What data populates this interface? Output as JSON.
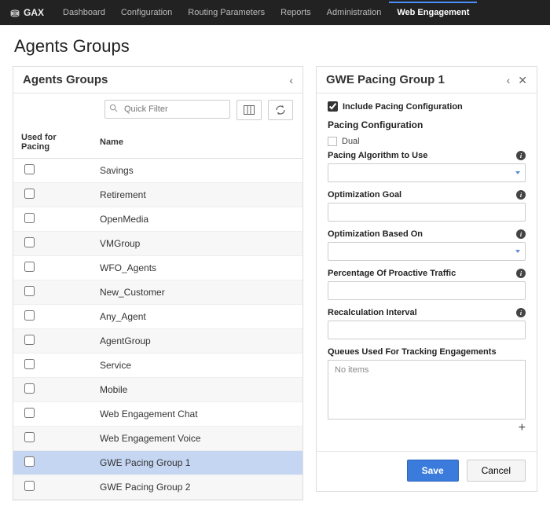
{
  "nav": {
    "brand": "GAX",
    "items": [
      "Dashboard",
      "Configuration",
      "Routing Parameters",
      "Reports",
      "Administration",
      "Web Engagement"
    ],
    "active": "Web Engagement"
  },
  "page": {
    "title": "Agents Groups"
  },
  "left": {
    "title": "Agents Groups",
    "search_placeholder": "Quick Filter",
    "columns": {
      "used": "Used for Pacing",
      "name": "Name"
    },
    "rows": [
      {
        "name": "Savings",
        "selected": false
      },
      {
        "name": "Retirement",
        "selected": false
      },
      {
        "name": "OpenMedia",
        "selected": false
      },
      {
        "name": "VMGroup",
        "selected": false
      },
      {
        "name": "WFO_Agents",
        "selected": false
      },
      {
        "name": "New_Customer",
        "selected": false
      },
      {
        "name": "Any_Agent",
        "selected": false
      },
      {
        "name": "AgentGroup",
        "selected": false
      },
      {
        "name": "Service",
        "selected": false
      },
      {
        "name": "Mobile",
        "selected": false
      },
      {
        "name": "Web Engagement Chat",
        "selected": false
      },
      {
        "name": "Web Engagement Voice",
        "selected": false
      },
      {
        "name": "GWE Pacing Group 1",
        "selected": true
      },
      {
        "name": "GWE Pacing Group 2",
        "selected": false
      }
    ]
  },
  "right": {
    "title": "GWE Pacing Group 1",
    "include_label": "Include Pacing Configuration",
    "include_checked": true,
    "section": "Pacing Configuration",
    "dual_label": "Dual",
    "fields": {
      "algorithm": "Pacing Algorithm to Use",
      "goal": "Optimization Goal",
      "based_on": "Optimization Based On",
      "percentage": "Percentage Of Proactive Traffic",
      "recalc": "Recalculation Interval",
      "queues": "Queues Used For Tracking Engagements",
      "queues_empty": "No items"
    },
    "buttons": {
      "save": "Save",
      "cancel": "Cancel"
    }
  }
}
